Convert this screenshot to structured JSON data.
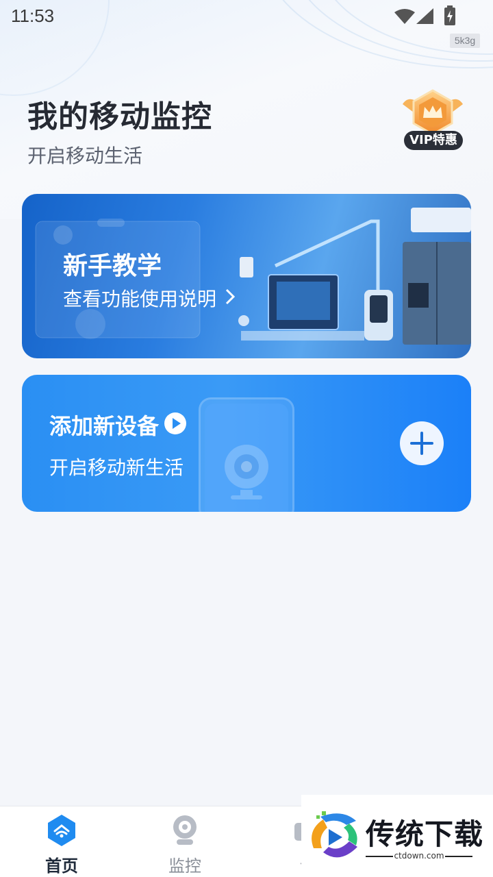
{
  "status_bar": {
    "time": "11:53",
    "network_badge": "5k3g"
  },
  "header": {
    "title": "我的移动监控",
    "subtitle": "开启移动生活",
    "vip_badge_label": "VIP特惠"
  },
  "tutorial_card": {
    "title": "新手教学",
    "subtitle": "查看功能使用说明"
  },
  "add_device_card": {
    "title": "添加新设备",
    "subtitle": "开启移动新生活"
  },
  "bottom_nav": {
    "items": [
      {
        "label": "首页",
        "icon": "home-icon",
        "active": true
      },
      {
        "label": "监控",
        "icon": "camera-icon",
        "active": false
      },
      {
        "label": "设",
        "icon": "settings-icon",
        "active": false
      }
    ]
  },
  "watermark": {
    "brand": "传统下载",
    "domain": "ctdown.com"
  },
  "colors": {
    "accent": "#1b80f8",
    "background": "#f4f6fa",
    "title": "#262a33"
  }
}
